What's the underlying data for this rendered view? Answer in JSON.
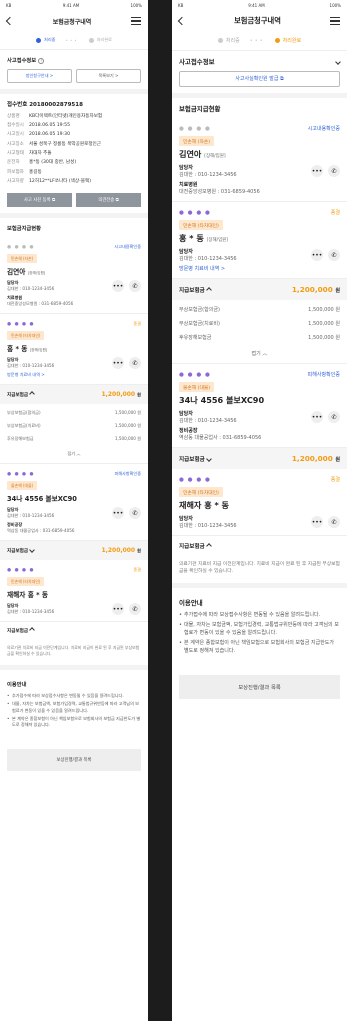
{
  "status": {
    "carrier": "KB",
    "time": "9:41 AM",
    "battery": "100%"
  },
  "nav": {
    "title": "보험금청구내역"
  },
  "steps": {
    "step1": "처리중",
    "step2": "처리완료"
  },
  "left": {
    "section_title": "사고접수정보",
    "btn_guide": "방인청구안내 >",
    "btn_contact": "목록보기 >",
    "receipt_no": "접수번호 20180002879518",
    "info": [
      {
        "k": "상품명",
        "v": "KB다이렉트(인터넷)개인용자동차보험"
      },
      {
        "k": "접수일시",
        "v": "2018.06.05 19:55"
      },
      {
        "k": "사고일시",
        "v": "2018.06.05 19:30"
      },
      {
        "k": "사고장소",
        "v": "서울 성북구 정릉동 북악공원로정인근"
      },
      {
        "k": "사고형태",
        "v": "차대차 추돌"
      },
      {
        "k": "운전자",
        "v": "홍*동 (30대 중반, 남성)"
      },
      {
        "k": "피보험자",
        "v": "홍길동"
      },
      {
        "k": "사고차량",
        "v": "12허12**LF쏘나타 (색상-블랙)"
      }
    ],
    "btn_photo": "사고 사진 등록",
    "btn_opinion": "의견전송",
    "status_title": "보험금지급현황",
    "card1": {
      "link": "시고내용확인중",
      "tag": "민손해 (자손)",
      "name": "김연아",
      "role": "[장해/입원]",
      "mgr_label": "담당자",
      "mgr": "김대한 : 010-1234-3456",
      "hosp_label": "치료병원",
      "hosp": "대전중앙성모병원 : 031-6859-4056"
    },
    "card2": {
      "link": "종결",
      "tag": "민손해 (타차대인)",
      "name": "홍 * 동",
      "role": "[장해/입원]",
      "mgr_label": "담당자",
      "mgr": "김대한 : 010-1234-3456",
      "hosp_link": "방문병 치료비 내역 >"
    },
    "amount": {
      "label": "지급보험금",
      "value": "1,200,000",
      "unit": "원"
    },
    "sub": [
      {
        "k": "부상보험금(합의금)",
        "v": "1,500,000 원"
      },
      {
        "k": "부상보험금(치료비)",
        "v": "1,500,000 원"
      },
      {
        "k": "후유장해보험금",
        "v": "1,500,000 원"
      }
    ],
    "fold": "접기",
    "card3": {
      "link": "피해사항확인중",
      "tag": "물손해 (대물)",
      "name": "34나 4556 볼보XC90",
      "mgr_label": "담당자",
      "mgr": "김대한 : 010-1234-3456",
      "hosp_label": "정비공장",
      "hosp": "역삼동 대물공업사 : 031-6859-4056"
    },
    "amount3": {
      "label": "지급보험금",
      "value": "1,200,000",
      "unit": "원"
    },
    "card4": {
      "link": "종결",
      "tag": "민손해 (타차대인)",
      "name": "재해자 홍 * 동",
      "mgr_label": "담당자",
      "mgr": "김대한 : 010-1234-3456"
    },
    "amount4": {
      "label": "지급보험금"
    },
    "notice": "의료기관 치료비 지급 이전단계입니다. 치료비 지급이 완료 된 후 지급된 부상보험금을 확인하실 수 있습니다.",
    "guide_title": "이용안내",
    "guide": [
      "추가접수에 따라 보상접수사항은 변동될 수 있음을 알려드립니다.",
      "대물, 자차는 보험금액, 보험가입경력, 교통법규위반등에 따라 고객님의 보험료가 변동이 있을 수 있음을 알려드립니다.",
      "본 계약은 종합보험이 아닌 책임보험으로 보험회사의 보험금 지급한도가 별도로 정해져 있습니다."
    ],
    "bottom_btn": "보상진행/결과 목록"
  },
  "right": {
    "section_title": "사고접수정보",
    "btn_doc": "사고사실확인원 발급",
    "status_title": "보험금지급현황",
    "card1": {
      "link": "시고내용확인중",
      "tag": "민손해 (자손)",
      "name": "김연아",
      "role": "[장해/입원]",
      "mgr_label": "담당자",
      "mgr": "김대한 : 010-1234-3456",
      "hosp_label": "치료병원",
      "hosp": "대전중앙성모병원 : 031-6859-4056"
    },
    "card2": {
      "link": "종결",
      "tag": "민손해 (타차대인)",
      "name": "홍 * 동",
      "role": "[장해/입원]",
      "mgr_label": "담당자",
      "mgr": "김대한 : 010-1234-3456",
      "hosp_link": "방문병 치료비 내역 >"
    },
    "amount": {
      "label": "지급보험금",
      "value": "1,200,000",
      "unit": "원"
    },
    "sub": [
      {
        "k": "부상보험금(합의금)",
        "v": "1,500,000 원"
      },
      {
        "k": "부상보험금(치료비)",
        "v": "1,500,000 원"
      },
      {
        "k": "후유장해보험금",
        "v": "1,500,000 원"
      }
    ],
    "fold": "접기",
    "card3": {
      "link": "피해사항확인중",
      "tag": "물손해 (대물)",
      "name": "34나 4556 볼보XC90",
      "mgr_label": "담당자",
      "mgr": "김대한 : 010-1234-3456",
      "hosp_label": "정비공장",
      "hosp": "역삼동 대물공업사 : 031-6859-4056"
    },
    "amount3": {
      "label": "지급보험금",
      "value": "1,200,000",
      "unit": "원"
    },
    "card4": {
      "link": "종결",
      "tag": "민손해 (타차대인)",
      "name": "재해자 홍 * 동",
      "mgr_label": "담당자",
      "mgr": "김대한 : 010-1234-3456"
    },
    "amount4": {
      "label": "지급보험금"
    },
    "notice": "의료기관 치료비 지급 이전단계입니다. 치료비 지급이 완료 된 후 지급된 부상보험금을 확인하실 수 있습니다.",
    "guide_title": "이용안내",
    "guide": [
      "추가접수에 따라 보상접수사항은 변동될 수 있음을 알려드립니다.",
      "대물, 자차는 보험금액, 보험가입경력, 교통법규위반등에 따라 고객님의 보험료가 변동이 있을 수 있음을 알려드립니다.",
      "본 계약은 종합보험이 아닌 책임보험으로 보험회사의 보험금 지급한도가 별도로 정해져 있습니다."
    ],
    "bottom_btn": "보상진행/결과 목록"
  }
}
